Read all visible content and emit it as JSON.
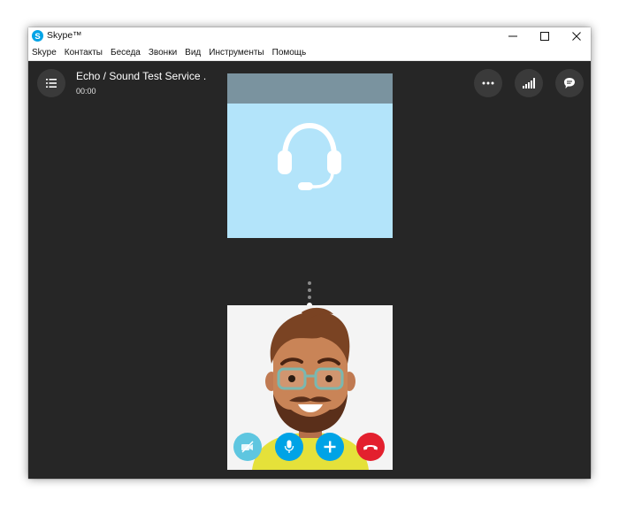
{
  "window": {
    "app_title": "Skype™"
  },
  "menu": [
    "Skype",
    "Контакты",
    "Беседа",
    "Звонки",
    "Вид",
    "Инструменты",
    "Помощь"
  ],
  "call": {
    "title": "Echo / Sound Test Service .",
    "timer": "00:00"
  },
  "colors": {
    "stage_bg": "#262626",
    "remote_tile_bg": "#b3e4fa",
    "remote_tile_header": "#7a939f",
    "accent_blue": "#00a3e6",
    "video_off": "#5ec6e0",
    "hangup_red": "#e3202e"
  },
  "icons": {
    "top_left": "call-list-icon",
    "top_right": [
      "more-options-icon",
      "call-quality-icon",
      "chat-icon"
    ],
    "remote_avatar": "headset-icon",
    "controls": [
      "video-off-icon",
      "microphone-icon",
      "add-icon",
      "hang-up-icon"
    ]
  }
}
